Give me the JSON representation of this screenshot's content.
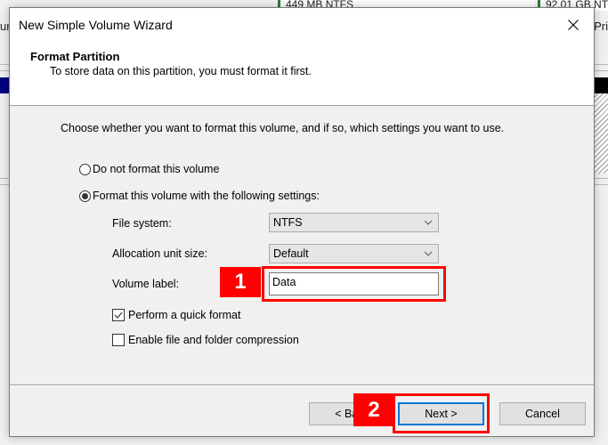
{
  "background": {
    "partition_labels": [
      "449 MB NTFS",
      "92.01 GB NT"
    ],
    "left_fragment": "ur",
    "right_fragment": "Pri"
  },
  "dialog": {
    "title": "New Simple Volume Wizard",
    "close_icon": "close-icon",
    "header": {
      "title": "Format Partition",
      "subtitle": "To store data on this partition, you must format it first."
    },
    "intro": "Choose whether you want to format this volume, and if so, which settings you want to use.",
    "options": [
      {
        "label": "Do not format this volume",
        "selected": false
      },
      {
        "label": "Format this volume with the following settings:",
        "selected": true
      }
    ],
    "fields": {
      "file_system": {
        "label": "File system:",
        "value": "NTFS"
      },
      "allocation_unit_size": {
        "label": "Allocation unit size:",
        "value": "Default"
      },
      "volume_label": {
        "label": "Volume label:",
        "value": "Data"
      }
    },
    "checkboxes": [
      {
        "label": "Perform a quick format",
        "checked": true
      },
      {
        "label": "Enable file and folder compression",
        "checked": false
      }
    ],
    "buttons": {
      "back": "< Back",
      "next": "Next >",
      "cancel": "Cancel"
    }
  },
  "annotations": [
    {
      "number": "1",
      "target": "volume-label-input",
      "color": "#ff0000"
    },
    {
      "number": "2",
      "target": "next-button",
      "color": "#ff0000"
    }
  ]
}
